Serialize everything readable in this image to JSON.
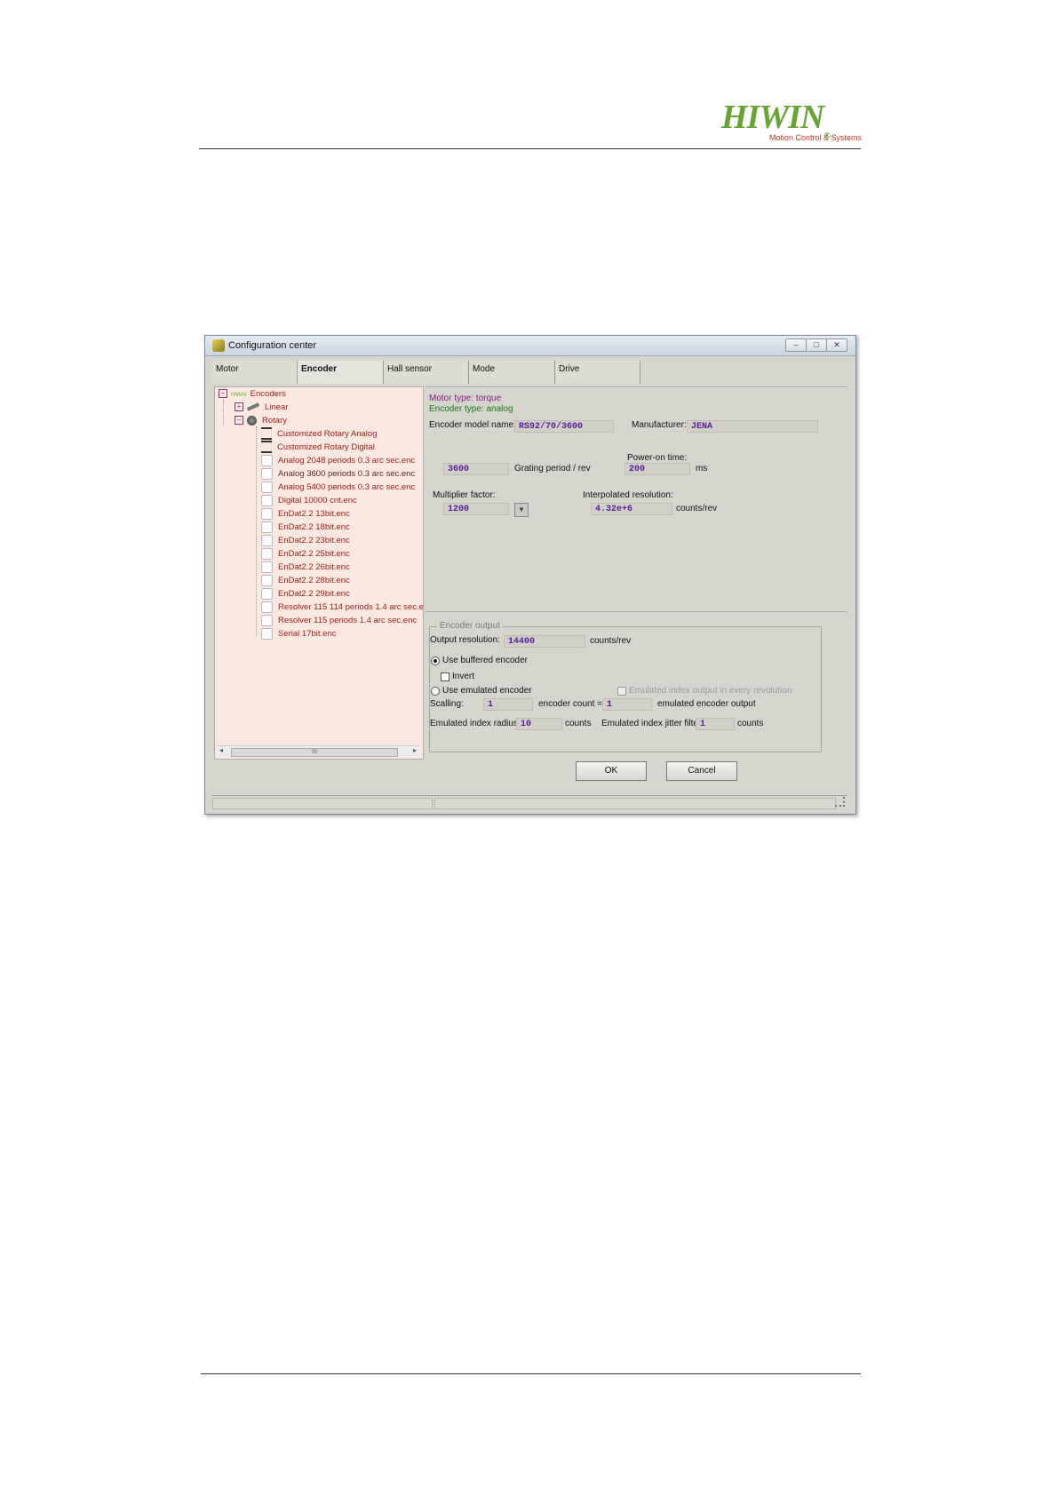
{
  "brand": {
    "name": "HIWIN",
    "registered": "®",
    "tagline": "Motion Control & Systems"
  },
  "window": {
    "title": "Configuration center",
    "controls": {
      "minimize": "–",
      "maximize": "□",
      "close": "✕"
    },
    "tabs": [
      "Motor",
      "Encoder",
      "Hall sensor",
      "Mode",
      "Drive"
    ],
    "active_tab": "Encoder"
  },
  "tree": {
    "root": "Encoders",
    "root_logo": "HIWIN",
    "linear": "Linear",
    "rotary": "Rotary",
    "items": [
      "Customized Rotary Analog",
      "Customized Rotary Digital",
      "Analog 2048 periods 0.3 arc sec.enc",
      "Analog 3600 periods 0.3 arc sec.enc",
      "Analog 5400 periods 0.3 arc sec.enc",
      "Digital 10000 cnt.enc",
      "EnDat2.2 13bit.enc",
      "EnDat2.2 18bit.enc",
      "EnDat2.2 23bit.enc",
      "EnDat2.2 25bit.enc",
      "EnDat2.2 26bit.enc",
      "EnDat2.2 28bit.enc",
      "EnDat2.2 29bit.enc",
      "Resolver 115 114 periods 1.4 arc sec.e",
      "Resolver 115 periods 1.4 arc sec.enc",
      "Serial 17bit.enc"
    ],
    "scroll_thumb_label": "III"
  },
  "encoder": {
    "motor_type": "Motor type: torque",
    "encoder_type": "Encoder type: analog",
    "model_name_label": "Encoder model name:",
    "model_name": "RS92/70/3600",
    "manufacturer_label": "Manufacturer:",
    "manufacturer": "JENA",
    "grating_value": "3600",
    "grating_label": "Grating period / rev",
    "power_on_label": "Power-on time:",
    "power_on_value": "200",
    "power_on_unit": "ms",
    "multiplier_label": "Multiplier factor:",
    "multiplier_value": "1200",
    "interp_label": "Interpolated resolution:",
    "interp_value": "4.32e+6",
    "interp_unit": "counts/rev"
  },
  "output": {
    "group_title": "Encoder output",
    "resolution_label": "Output resolution:",
    "resolution_value": "14400",
    "resolution_unit": "counts/rev",
    "use_buffered": "Use buffered encoder",
    "invert": "Invert",
    "use_emulated": "Use emulated encoder",
    "emulated_index_every_rev": "Emulated index output in every revolution",
    "scaling_label": "Scalling:",
    "scaling_value": "1",
    "encoder_count_label": "encoder count =",
    "encoder_count_value": "1",
    "emulated_output_label": "emulated encoder output",
    "index_radius_label": "Emulated index radius:",
    "index_radius_value": "10",
    "index_radius_unit": "counts",
    "jitter_label": "Emulated index jitter filter:",
    "jitter_value": "1",
    "jitter_unit": "counts"
  },
  "buttons": {
    "ok": "OK",
    "cancel": "Cancel"
  }
}
